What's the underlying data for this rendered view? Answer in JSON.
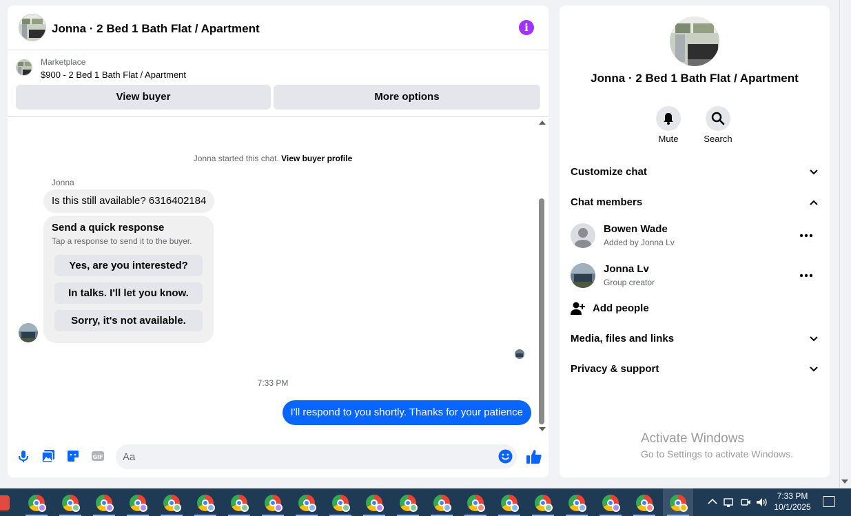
{
  "chat": {
    "title": "Jonna · 2 Bed 1 Bath Flat / Apartment",
    "listing_source": "Marketplace",
    "listing_price": "$900 - 2 Bed 1 Bath Flat / Apartment",
    "view_buyer_label": "View buyer",
    "more_options_label": "More options",
    "started_prefix": "Jonna started this chat.",
    "started_link": "View buyer profile",
    "sender_name": "Jonna",
    "incoming_message": "Is this still available? 6316402184",
    "quick_title": "Send a quick response",
    "quick_sub": "Tap a response to send it to the buyer.",
    "quick_responses": [
      "Yes, are you interested?",
      "In talks. I'll let you know.",
      "Sorry, it's not available."
    ],
    "timestamp": "7:33 PM",
    "outgoing_message": "I'll respond to you shortly. Thanks for your patience",
    "input_placeholder": "Aa"
  },
  "details": {
    "title": "Jonna · 2 Bed 1 Bath Flat / Apartment",
    "mute_label": "Mute",
    "search_label": "Search",
    "customize_chat": "Customize chat",
    "chat_members": "Chat members",
    "members": [
      {
        "name": "Bowen Wade",
        "role": "Added by Jonna Lv"
      },
      {
        "name": "Jonna Lv",
        "role": "Group creator"
      }
    ],
    "add_people": "Add people",
    "media_files_links": "Media, files and links",
    "privacy_support": "Privacy & support"
  },
  "watermark": {
    "line1": "Activate Windows",
    "line2": "Go to Settings to activate Windows."
  },
  "taskbar": {
    "time": "7:33 PM",
    "date": "10/1/2025",
    "icons": [
      "chrome-icon",
      "up-arrow-icon",
      "network-icon",
      "meeting-icon",
      "volume-icon",
      "notification-icon"
    ]
  },
  "colors": {
    "accent": "#0866ff",
    "info": "#a033ff",
    "taskbar": "#1f3a55"
  }
}
